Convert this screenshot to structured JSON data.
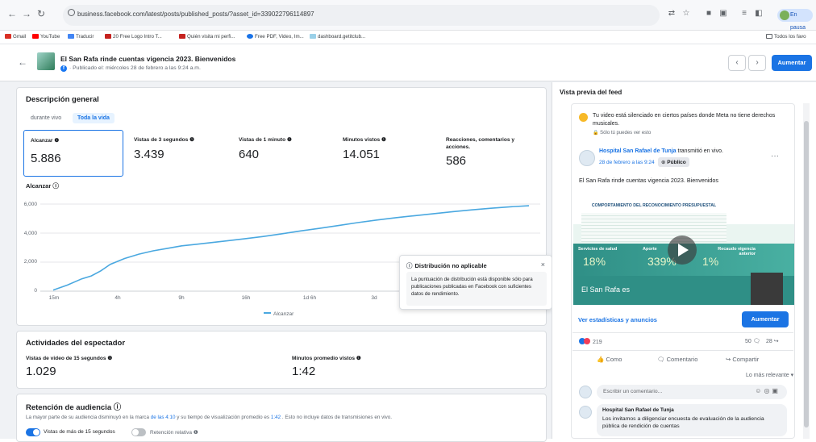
{
  "browser": {
    "url": "business.facebook.com/latest/posts/published_posts/?asset_id=339022796114897",
    "pause_label": "En pausa",
    "bookmarks": [
      "Gmail",
      "YouTube",
      "Traducir",
      "20 Free Logo Intro T...",
      "Quién visita mi perfi...",
      "Free PDF, Video, Im...",
      "dashboard.getitclub..."
    ],
    "all_bookmarks": "Todos los favo"
  },
  "header": {
    "title": "El San Rafa rinde cuentas vigencia 2023. Bienvenidos",
    "subtitle": "· Publicado el: miércoles 28 de febrero a las 9:24 a.m.",
    "boost_label": "Aumentar"
  },
  "overview": {
    "title": "Descripción general",
    "tabs": [
      "durante vivo",
      "Toda la vida"
    ],
    "metrics": [
      {
        "label": "Alcanzar ❶",
        "value": "5.886"
      },
      {
        "label": "Vistas de 3 segundos ❶",
        "value": "3.439"
      },
      {
        "label": "Vistas de 1 minuto ❶",
        "value": "640"
      },
      {
        "label": "Minutos vistos ❶",
        "value": "14.051"
      },
      {
        "label": "Reacciones, comentarios y acciones.",
        "value": "586"
      }
    ],
    "chart_title": "Alcanzar ⓘ",
    "legend": "Alcanzar"
  },
  "chart_data": {
    "type": "line",
    "title": "Alcanzar",
    "ylim": [
      0,
      6000
    ],
    "yticks": [
      "6,000",
      "4,000",
      "2,000",
      "0"
    ],
    "xticks": [
      "15m",
      "4h",
      "9h",
      "16h",
      "1d 6h",
      "3d"
    ],
    "series": [
      {
        "name": "Alcanzar",
        "color": "#4aa8e0",
        "points": [
          [
            0,
            80
          ],
          [
            0.03,
            420
          ],
          [
            0.06,
            850
          ],
          [
            0.08,
            1050
          ],
          [
            0.1,
            1400
          ],
          [
            0.12,
            1850
          ],
          [
            0.15,
            2250
          ],
          [
            0.18,
            2550
          ],
          [
            0.21,
            2780
          ],
          [
            0.24,
            2950
          ],
          [
            0.27,
            3120
          ],
          [
            0.3,
            3230
          ],
          [
            0.33,
            3340
          ],
          [
            0.36,
            3450
          ],
          [
            0.4,
            3600
          ],
          [
            0.44,
            3760
          ],
          [
            0.48,
            3950
          ],
          [
            0.52,
            4150
          ],
          [
            0.56,
            4330
          ],
          [
            0.6,
            4520
          ],
          [
            0.64,
            4720
          ],
          [
            0.68,
            4900
          ],
          [
            0.72,
            5060
          ],
          [
            0.76,
            5200
          ],
          [
            0.8,
            5340
          ],
          [
            0.84,
            5480
          ],
          [
            0.88,
            5600
          ],
          [
            0.92,
            5710
          ],
          [
            0.96,
            5810
          ],
          [
            1,
            5886
          ]
        ]
      }
    ]
  },
  "tooltip": {
    "title": "Distribución no aplicable",
    "body": "La puntuación de distribución está disponible sólo para publicaciones publicadas en Facebook con suficientes datos de rendimiento."
  },
  "viewer": {
    "title": "Actividades del espectador",
    "metrics": [
      {
        "label": "Vistas de video de 15 segundos ❶",
        "value": "1.029"
      },
      {
        "label": "Minutos promedio vistos ❶",
        "value": "1:42"
      }
    ]
  },
  "retention": {
    "title": "Retención de audiencia ⓘ",
    "desc_pre": "La mayor parte de su audiencia disminuyó en la marca ",
    "desc_link1": "de las 4:10",
    "desc_mid": " y su tiempo de visualización promedio es ",
    "desc_link2": "1:42",
    "desc_post": " . Esto no incluye datos de transmisiones en vivo.",
    "toggle1": "Vistas de más de 15 segundos",
    "toggle2": "Retención relativa ❶"
  },
  "feed": {
    "title": "Vista previa del feed",
    "notice": "Tu video está silenciado en ciertos países donde Meta no tiene derechos musicales.",
    "notice_sub": "Sólo tú puedes ver esto",
    "page_name": "Hospital San Rafael de Tunja",
    "page_action": " transmitió en vivo.",
    "date": "28 de febrero a las 9:24",
    "privacy": "Público",
    "caption": "El San Rafa rinde cuentas vigencia 2023. Bienvenidos",
    "video": {
      "heading": "COMPORTAMIENTO DEL RECONOCIMIENTO PRESUPUESTAL",
      "label1": "Servicios de salud",
      "label2": "Aporte",
      "label3": "Recaudo vigencia anterior",
      "p1": "18%",
      "p2": "339%",
      "p3": "1%",
      "footer": "El San Rafa es"
    },
    "stats_link": "Ver estadísticas y anuncios",
    "boost": "Aumentar",
    "reactions": "219",
    "comments": "50",
    "shares": "28",
    "actions": [
      "Como",
      "Comentario",
      "Compartir"
    ],
    "sort": "Lo más relevante ▾",
    "comment_placeholder": "Escribir un comentario...",
    "comment_author": "Hospital San Rafael de Tunja",
    "comment_text": "Los invitamos a diligenciar encuesta de evaluación de la audiencia pública de rendición de cuentas"
  }
}
